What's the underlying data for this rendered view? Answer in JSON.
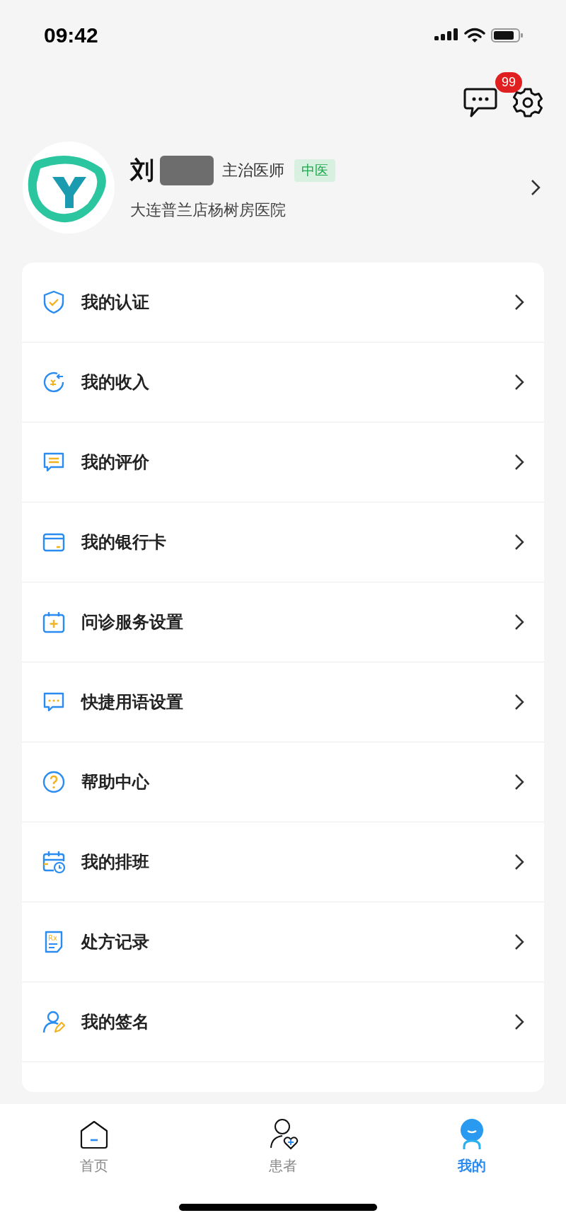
{
  "status_bar": {
    "time": "09:42"
  },
  "header": {
    "message_badge": "99"
  },
  "profile": {
    "name": "刘",
    "title": "主治医师",
    "tag": "中医",
    "hospital": "大连普兰店杨树房医院"
  },
  "menu": [
    {
      "kind": "shield",
      "label": "我的认证"
    },
    {
      "kind": "income",
      "label": "我的收入"
    },
    {
      "kind": "comment",
      "label": "我的评价"
    },
    {
      "kind": "card",
      "label": "我的银行卡"
    },
    {
      "kind": "calendar-plus",
      "label": "问诊服务设置"
    },
    {
      "kind": "chat",
      "label": "快捷用语设置"
    },
    {
      "kind": "help",
      "label": "帮助中心"
    },
    {
      "kind": "schedule",
      "label": "我的排班"
    },
    {
      "kind": "rx",
      "label": "处方记录",
      "icon_text": "Rx"
    },
    {
      "kind": "signature",
      "label": "我的签名"
    }
  ],
  "tabs": [
    {
      "kind": "home",
      "label": "首页",
      "selected": false
    },
    {
      "kind": "patients",
      "label": "患者",
      "selected": false
    },
    {
      "kind": "me",
      "label": "我的",
      "selected": true
    }
  ]
}
